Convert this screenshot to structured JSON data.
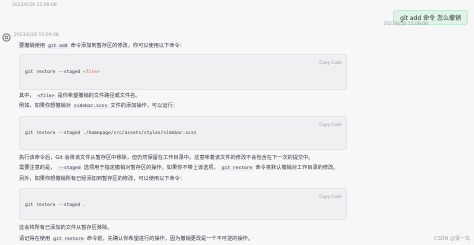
{
  "timestamps": {
    "top": "2023/6/26 15:09:08",
    "user": "2023/6/26 15:09:08",
    "assistant": "2023/6/26 15:09:08"
  },
  "user_message": "git add 命令 怎么撤销",
  "assistant": {
    "p1_pre": "要撤销使用",
    "p1_code": "git add",
    "p1_post": "命令添加到暂存区的修改，你可以使用以下命令：",
    "copy_label": "Copy Code",
    "code1_cmd": "git restore --staged",
    "code1_arg": "<file>",
    "p2_pre": "其中，",
    "p2_code": "<file>",
    "p2_post": "是你希望撤销的文件路径或文件名。",
    "p3_pre": "例如，如果你想撤销对",
    "p3_code": "sidebar.scss",
    "p3_post": "文件的添加操作，可以运行：",
    "code2": "git restore --staged ./homepage/src/assets/styles/sidebar.scss",
    "p4": "执行该命令后，Git 会将该文件从暂存区中移除，但仍然保留在工作目录中。这意味着该文件的修改不会包含在下一次的提交中。",
    "p5_pre": "需要注意的是，",
    "p5_code1": "--staged",
    "p5_mid": "选项用于指定撤销对暂存区的操作。如果你不带上该选项，",
    "p5_code2": "git restore",
    "p5_post": "命令将默认撤销对工作目录的修改。",
    "p6": "另外，如果你想撤销所有已经添加到暂存区的修改，可以使用以下命令：",
    "code3": "git restore --staged .",
    "p7": "这会将所有已添加的文件从暂存区移除。",
    "p8_pre": "请记得在使用",
    "p8_code": "git restore",
    "p8_post": "命令前，先确认你希望进行的操作，因为撤销更改是一个不可逆的操作。"
  },
  "watermark": "CSDN @贤一鸟"
}
